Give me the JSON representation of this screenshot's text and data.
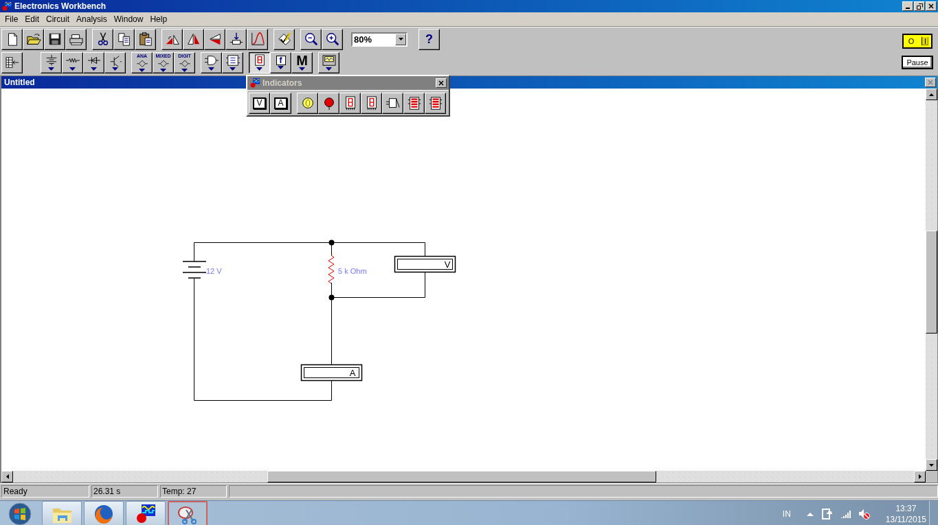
{
  "app_window": {
    "title": "Electronics Workbench"
  },
  "menu": [
    "File",
    "Edit",
    "Circuit",
    "Analysis",
    "Window",
    "Help"
  ],
  "toolbar": {
    "groups": [
      [
        {
          "kind": "new"
        },
        {
          "kind": "open"
        },
        {
          "kind": "save"
        },
        {
          "kind": "print"
        }
      ],
      [
        {
          "kind": "cut"
        },
        {
          "kind": "copy"
        },
        {
          "kind": "paste"
        }
      ],
      [
        {
          "kind": "rotate"
        },
        {
          "kind": "flip-horizontal"
        },
        {
          "kind": "flip-vertical"
        },
        {
          "kind": "subcircuit"
        },
        {
          "kind": "graph"
        }
      ],
      [
        {
          "kind": "description"
        }
      ],
      [
        {
          "kind": "zoom-out"
        },
        {
          "kind": "zoom-in"
        }
      ]
    ],
    "zoom": "80%",
    "help": "?"
  },
  "parts_bin": {
    "groups": [
      [
        {
          "kind": "bin-toggle",
          "selected": false
        }
      ],
      [
        {
          "kind": "sources",
          "selected": false
        },
        {
          "kind": "basic",
          "selected": false
        },
        {
          "kind": "diodes",
          "selected": false
        },
        {
          "kind": "transistors",
          "selected": false
        }
      ],
      [
        {
          "kind": "ic",
          "label": "ANA",
          "selected": false
        },
        {
          "kind": "ic",
          "label": "MIXED",
          "selected": false
        },
        {
          "kind": "ic",
          "label": "DIGIT",
          "selected": false
        }
      ],
      [
        {
          "kind": "gates",
          "selected": false
        },
        {
          "kind": "digital",
          "selected": false
        }
      ],
      [
        {
          "kind": "indicators",
          "selected": true
        },
        {
          "kind": "controls",
          "label": "f",
          "selected": false
        },
        {
          "kind": "misc",
          "label": "M",
          "selected": false
        }
      ],
      [
        {
          "kind": "instruments",
          "selected": false
        }
      ]
    ]
  },
  "simulation": {
    "switch": {
      "off_label": "O",
      "on_label": "I",
      "on": true
    },
    "pause": "Pause"
  },
  "circuit_window": {
    "title": "Untitled",
    "components": [
      {
        "kind": "battery",
        "label": "12 V"
      },
      {
        "kind": "resistor",
        "label": "5 k Ohm"
      },
      {
        "kind": "voltmeter",
        "label": "V"
      },
      {
        "kind": "ammeter",
        "label": "A"
      }
    ]
  },
  "indicators_palette": {
    "title": "Indicators",
    "buttons": [
      {
        "kind": "voltmeter",
        "label": "V"
      },
      {
        "kind": "ammeter",
        "label": "A"
      },
      {
        "kind": "bulb"
      },
      {
        "kind": "probe"
      },
      {
        "kind": "seven-segment-decoded"
      },
      {
        "kind": "seven-segment"
      },
      {
        "kind": "buzzer"
      },
      {
        "kind": "bargraph"
      },
      {
        "kind": "bargraph-decoded"
      }
    ]
  },
  "status_bar": [
    "Ready",
    "26.31 s",
    "Temp: 27"
  ],
  "taskbar": {
    "apps": [
      {
        "kind": "folder",
        "selected": false
      },
      {
        "kind": "firefox",
        "selected": false
      },
      {
        "kind": "workbench",
        "selected": false
      },
      {
        "kind": "snipping",
        "selected": true
      }
    ],
    "tray": {
      "language": "IN",
      "time": "13:37",
      "date": "13/11/2015"
    }
  }
}
